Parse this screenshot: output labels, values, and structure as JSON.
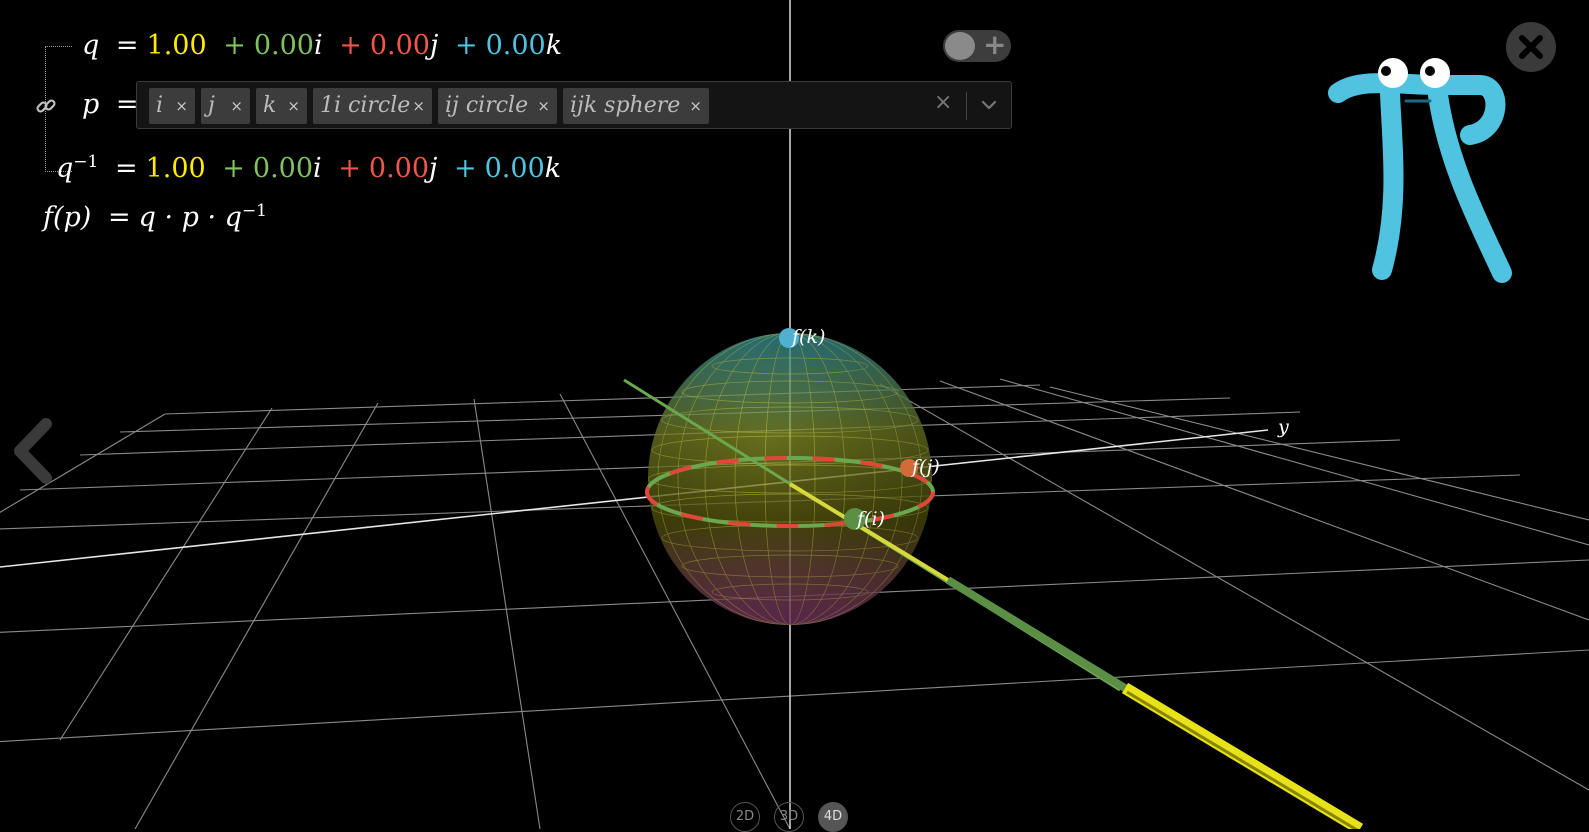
{
  "equations": {
    "q": {
      "var": "q",
      "eq": "=",
      "real": "1.00",
      "i": "0.00",
      "j": "0.00",
      "k": "0.00"
    },
    "p": {
      "var": "p",
      "eq": "="
    },
    "qinv": {
      "var": "q",
      "sup": "−1",
      "eq": "=",
      "real": "1.00",
      "i": "0.00",
      "j": "0.00",
      "k": "0.00"
    },
    "f": {
      "lhs": "f(p)",
      "eq": "=",
      "rhs": "q · p · q",
      "sup": "−1"
    }
  },
  "p_tags": [
    {
      "label": "i",
      "remove": "×"
    },
    {
      "label": "j",
      "remove": "×"
    },
    {
      "label": "k",
      "remove": "×"
    },
    {
      "label": "1i circle",
      "remove": "×"
    },
    {
      "label": "ij circle",
      "remove": "×"
    },
    {
      "label": "ijk sphere",
      "remove": "×"
    }
  ],
  "select": {
    "clear": "×"
  },
  "toggle": {
    "plus": "+",
    "on": false
  },
  "scene": {
    "labels": {
      "fk": "f(k)",
      "fj": "f(j)",
      "fi": "f(i)",
      "y": "y"
    }
  },
  "dimension_buttons": [
    {
      "label": "2D",
      "active": false
    },
    {
      "label": "3D",
      "active": false
    },
    {
      "label": "4D",
      "active": true
    }
  ],
  "colors": {
    "real": "#ffea00",
    "i": "#7fc25f",
    "j": "#f0574a",
    "k": "#4fc3df",
    "mascot": "#4fc3df"
  },
  "icons": [
    "link-icon",
    "chevron-down-icon",
    "close-icon",
    "back-arrow-icon",
    "pi-mascot-icon",
    "toggle-plus-icon"
  ]
}
